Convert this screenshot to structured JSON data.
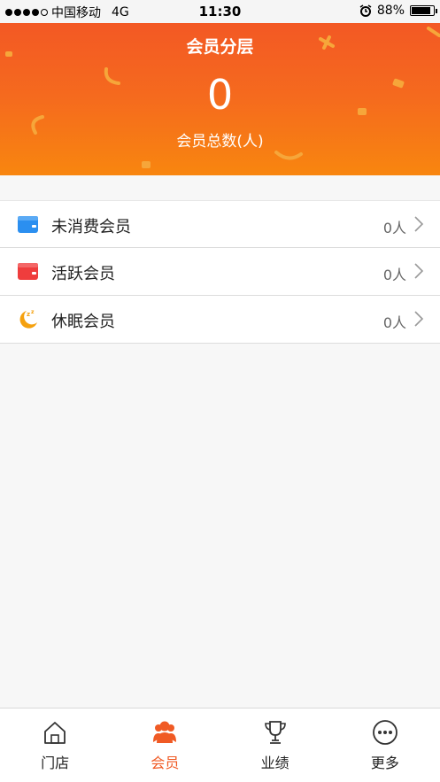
{
  "status_bar": {
    "carrier": "中国移动",
    "network": "4G",
    "time": "11:30",
    "battery": "88%"
  },
  "header": {
    "title": "会员分层",
    "total_value": "0",
    "total_label": "会员总数(人)"
  },
  "segments": [
    {
      "label": "未消费会员",
      "count": "0人",
      "icon": "wallet-blue-icon",
      "color": "#2b8ff0"
    },
    {
      "label": "活跃会员",
      "count": "0人",
      "icon": "wallet-red-icon",
      "color": "#ef3d3d"
    },
    {
      "label": "休眠会员",
      "count": "0人",
      "icon": "moon-sleep-icon",
      "color": "#f5a10f"
    }
  ],
  "tabbar": {
    "tabs": [
      {
        "label": "门店",
        "icon": "store-icon"
      },
      {
        "label": "会员",
        "icon": "members-icon",
        "active": true
      },
      {
        "label": "业绩",
        "icon": "trophy-icon"
      },
      {
        "label": "更多",
        "icon": "more-icon"
      }
    ]
  },
  "colors": {
    "accent": "#f05a24",
    "header_top": "#f25326",
    "header_bottom": "#f8860f"
  }
}
